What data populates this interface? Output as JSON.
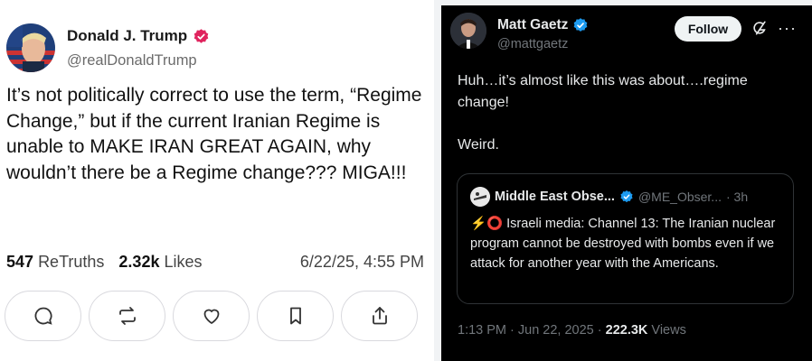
{
  "truth_post": {
    "name": "Donald J. Trump",
    "handle": "@realDonaldTrump",
    "body": "It’s not politically correct to use the term, “Regime Change,” but if the current Iranian Regime is unable to MAKE IRAN GREAT AGAIN, why wouldn’t there be a Regime change??? MIGA!!!",
    "retruths_count": "547",
    "retruths_label": "ReTruths",
    "likes_count": "2.32k",
    "likes_label": "Likes",
    "date": "6/22/25, 4:55 PM",
    "actions": [
      "reply-icon",
      "retruth-icon",
      "like-icon",
      "bookmark-icon",
      "share-icon"
    ],
    "verified_color": "#e0245e"
  },
  "x_post": {
    "name": "Matt Gaetz",
    "handle": "@mattgaetz",
    "follow_label": "Follow",
    "more_label": "···",
    "text": "Huh…it’s almost like this was about….regime change!",
    "text2": "Weird.",
    "quote": {
      "name": "Middle East Obse...",
      "handle": "@ME_Obser...",
      "time": "· 3h",
      "body": "Israeli media: Channel 13: The Iranian nuclear program cannot be destroyed with bombs even if we attack for another year with the Americans."
    },
    "meta_time": "1:13 PM · Jun 22, 2025 · ",
    "views_count": "222.3K",
    "views_label": " Views",
    "verified_color": "#1d9bf0"
  }
}
